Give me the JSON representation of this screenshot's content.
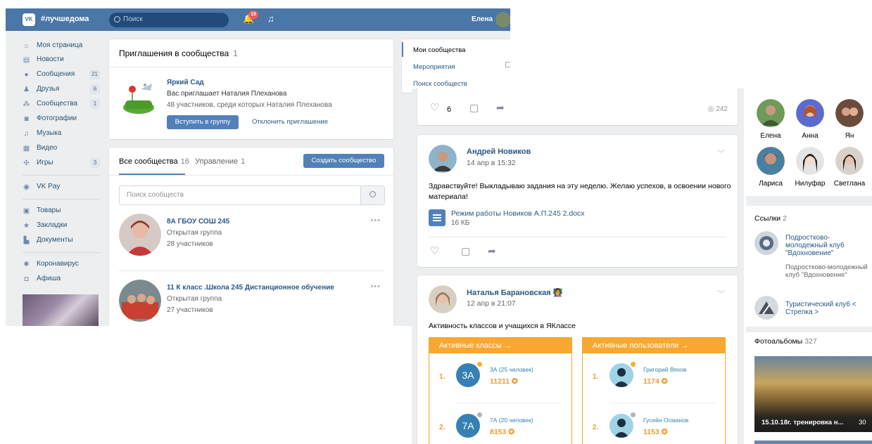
{
  "header": {
    "logo": "VK",
    "community_tag": "#лучшедома",
    "search_placeholder": "Поиск",
    "notifications_count": "15",
    "user_name": "Елена"
  },
  "left_nav": {
    "items": [
      {
        "label": "Моя страница",
        "icon": "home-icon"
      },
      {
        "label": "Новости",
        "icon": "news-icon"
      },
      {
        "label": "Сообщения",
        "icon": "messages-icon",
        "count": "21"
      },
      {
        "label": "Друзья",
        "icon": "friends-icon",
        "count": "6"
      },
      {
        "label": "Сообщества",
        "icon": "communities-icon",
        "count": "1"
      },
      {
        "label": "Фотографии",
        "icon": "camera-icon"
      },
      {
        "label": "Музыка",
        "icon": "music-icon"
      },
      {
        "label": "Видео",
        "icon": "video-icon"
      },
      {
        "label": "Игры",
        "icon": "games-icon",
        "count": "3"
      },
      {
        "label": "VK Pay",
        "icon": "vkpay-icon"
      },
      {
        "label": "Товары",
        "icon": "shop-icon"
      },
      {
        "label": "Закладки",
        "icon": "star-icon"
      },
      {
        "label": "Документы",
        "icon": "document-icon"
      },
      {
        "label": "Коронавирус",
        "icon": "virus-icon"
      },
      {
        "label": "Афиша",
        "icon": "poster-icon"
      }
    ]
  },
  "invites": {
    "title": "Приглашения в сообщества",
    "count": "1",
    "group_name": "Яркий Сад",
    "invited_by": "Вас приглашает Наталия Плеханова",
    "members": "48 участников, среди которых Наталия Плеханова",
    "join_label": "Вступить в группу",
    "decline_label": "Отклонить приглашение"
  },
  "communities": {
    "tab_all": "Все сообщества",
    "tab_all_count": "16",
    "tab_manage": "Управление",
    "tab_manage_count": "1",
    "create_label": "Создать сообщество",
    "search_placeholder": "Поиск сообществ",
    "groups": [
      {
        "name": "8А ГБОУ СОШ 245",
        "type": "Открытая группа",
        "members": "28 участников"
      },
      {
        "name": "11 К класс .Школа 245 Дистанционное обучение",
        "type": "Открытая группа",
        "members": "27 участников"
      }
    ]
  },
  "right_menu": {
    "items": [
      "Мои сообщества",
      "Мероприятия",
      "Поиск сообществ"
    ]
  },
  "feed": {
    "post0": {
      "likes": "6",
      "views": "242"
    },
    "post1": {
      "author": "Андрей Новиков",
      "date": "14 апр в 15:32",
      "text": "Здравствуйте! Выкладываю задания на эту неделю. Желаю успехов, в освоении нового материала!",
      "doc_name": "Режим работы Новиков А.П.245 2.docx",
      "doc_size": "16 КБ"
    },
    "post2": {
      "author": "Наталья Барановская",
      "date": "12 апр в 21:07",
      "text": "Активность классов и учащихся в ЯКлассе",
      "classes_header": "Активные классы →",
      "users_header": "Активные пользователи →",
      "classes": [
        {
          "rank": "1.",
          "badge": "3А",
          "name": "3А (25 человек)",
          "points": "11211"
        },
        {
          "rank": "2.",
          "badge": "7А",
          "name": "7А (20 человек)",
          "points": "8153"
        }
      ],
      "users": [
        {
          "rank": "1.",
          "name": "Григорий Вяхов",
          "points": "1174"
        },
        {
          "rank": "2.",
          "name": "Гусейн Османов",
          "points": "1153"
        }
      ]
    }
  },
  "sidebar": {
    "friends": [
      "Елена",
      "Анна",
      "Ян",
      "Лариса",
      "Нилуфар",
      "Светлана"
    ],
    "links_title": "Ссылки",
    "links_count": "2",
    "links": [
      {
        "name": "Подростково-молодежный клуб \"Вдохновение\"",
        "desc": "Подростково-молодежный клуб \"Вдохновение\""
      },
      {
        "name": "Туристический клуб < Стрелка >",
        "desc": ""
      }
    ],
    "albums_title": "Фотоальбомы",
    "albums_count": "327",
    "album_caption": "15.10.18г. тренировка н...",
    "album_photos": "30"
  },
  "colors": {
    "vk_blue": "#4a76a8",
    "button_blue": "#5181b8",
    "link_blue": "#2a5885",
    "yaklass_orange": "#f7a830"
  }
}
